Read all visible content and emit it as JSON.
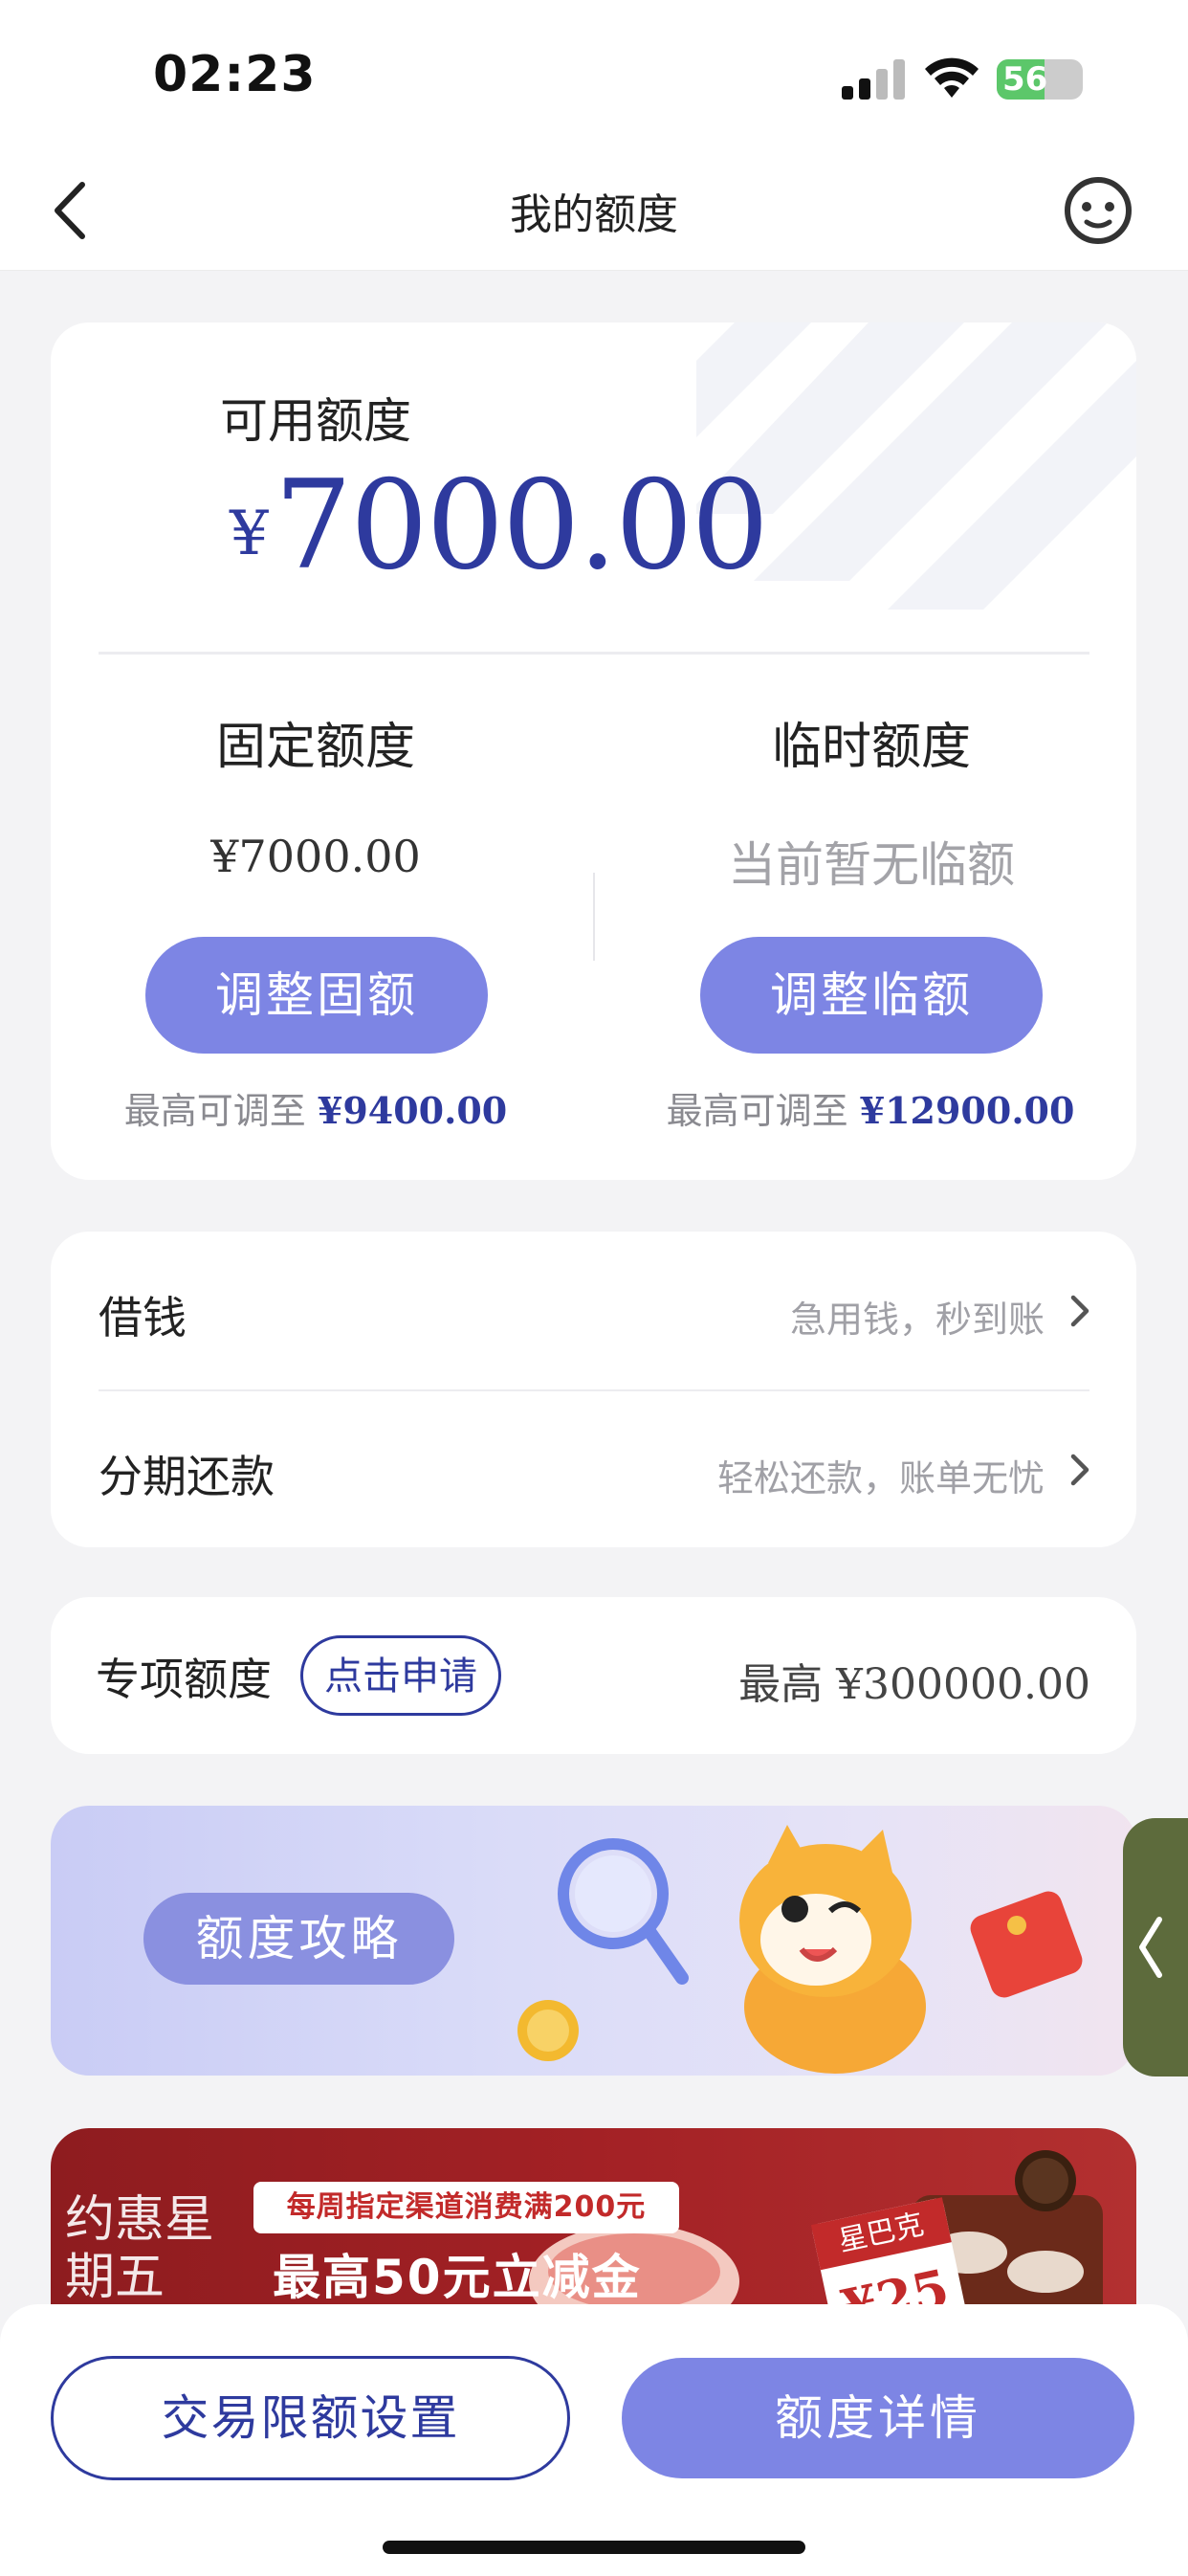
{
  "status_bar": {
    "time": "02:23",
    "battery": "56",
    "battery_level": 0.56
  },
  "nav": {
    "title": "我的额度",
    "back_icon": "chevron-left-icon",
    "service_icon": "customer-service-icon"
  },
  "credit": {
    "available_label": "可用额度",
    "currency_symbol": "¥",
    "available_amount": "7000.00",
    "fixed": {
      "title": "固定额度",
      "value": "¥7000.00",
      "button": "调整固额",
      "max_prefix": "最高可调至",
      "max_value": "¥9400.00"
    },
    "temporary": {
      "title": "临时额度",
      "value": "当前暂无临额",
      "button": "调整临额",
      "max_prefix": "最高可调至",
      "max_value": "¥12900.00"
    }
  },
  "list": [
    {
      "label": "借钱",
      "hint": "急用钱，秒到账"
    },
    {
      "label": "分期还款",
      "hint": "轻松还款，账单无忧"
    }
  ],
  "special": {
    "label": "专项额度",
    "apply": "点击申请",
    "max": "最高 ¥300000.00"
  },
  "banner1": {
    "pill": "额度攻略"
  },
  "banner2": {
    "top": "每周指定渠道消费满200元",
    "main": "最高50元立减金",
    "left": "约惠星期五",
    "brand": "星巴克",
    "coupon": "¥25"
  },
  "bottom": {
    "limit_settings": "交易限额设置",
    "credit_details": "额度详情"
  },
  "colors": {
    "primary": "#2e3a9e",
    "button": "#7d85e4",
    "banner_red": "#a32125"
  }
}
